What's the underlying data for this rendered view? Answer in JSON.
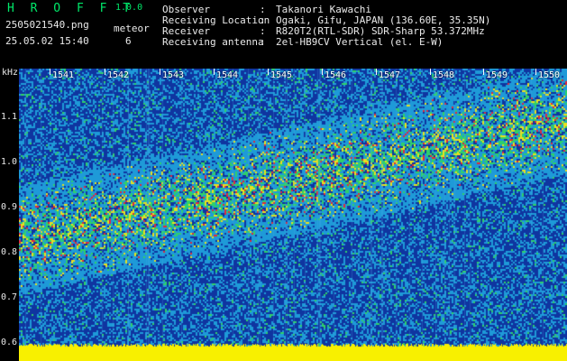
{
  "header": {
    "app_title": "H R O F F T",
    "app_version": "1.0.0",
    "filename": "2505021540.png",
    "datetime": "25.05.02 15:40",
    "meteor_label": "meteor",
    "meteor_count": "6"
  },
  "info": [
    {
      "label": "Observer",
      "value": "Takanori Kawachi"
    },
    {
      "label": "Receiving Location",
      "value": "Ogaki, Gifu, JAPAN (136.60E, 35.35N)"
    },
    {
      "label": "Receiver",
      "value": "R820T2(RTL-SDR) SDR-Sharp 53.372MHz"
    },
    {
      "label": "Receiving antenna",
      "value": "2el-HB9CV Vertical (el. E-W)"
    }
  ],
  "info_separator": ":",
  "chart_data": {
    "type": "heatmap",
    "y_unit_label": "kHz",
    "x_ticks": [
      "1541",
      "1542",
      "1543",
      "1544",
      "1545",
      "1546",
      "1547",
      "1548",
      "1549",
      "1550"
    ],
    "y_ticks": [
      "1.1",
      "1.0",
      "0.9",
      "0.8",
      "0.7",
      "0.6"
    ],
    "y_range_khz": [
      0.58,
      1.2
    ],
    "x_range_minutes": [
      1540.6,
      1550.4
    ],
    "colors": {
      "background": "#0f35a0",
      "noise": "#1e9ad8",
      "signal_mid": "#2fd06a",
      "signal_high": "#e8e020",
      "signal_peak": "#e0283c",
      "floor": "#f8f000"
    }
  }
}
